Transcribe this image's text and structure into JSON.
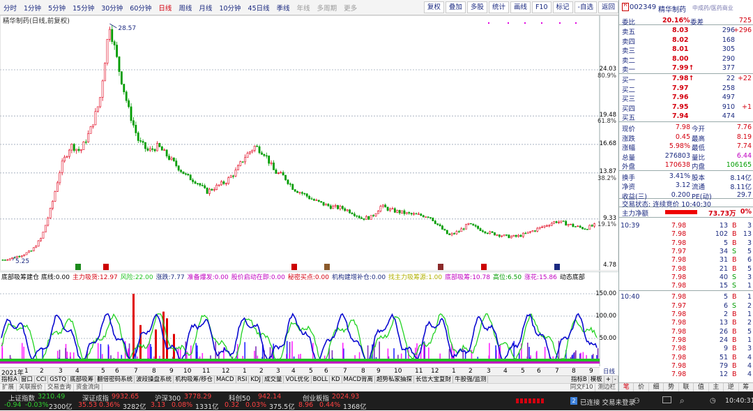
{
  "periods": [
    "分时",
    "1分钟",
    "5分钟",
    "15分钟",
    "30分钟",
    "60分钟",
    "日线",
    "周线",
    "月线",
    "10分钟",
    "45日线",
    "季线",
    "年线",
    "多周期",
    "更多"
  ],
  "active_period": "日线",
  "toolbar_buttons": [
    "复权",
    "叠加",
    "多股",
    "统计",
    "画线",
    "F10",
    "标记",
    "-自选",
    "返回"
  ],
  "chart_title": "精华制药(日线,前复权)",
  "price_axis": [
    "24.03",
    "19.48",
    "16.68",
    "13.87",
    "9.33",
    "4.78"
  ],
  "pct_axis": [
    "80.9%",
    "61.8%",
    "38.2%",
    "19.1%"
  ],
  "high_label": "28.57",
  "low_label": "5.25",
  "chart_data": {
    "type": "line",
    "title": "精华制药(日线,前复权)",
    "x": [
      "2021年",
      "1",
      "2",
      "3",
      "4",
      "5",
      "6",
      "7",
      "8",
      "9",
      "10",
      "11",
      "12",
      "1",
      "2",
      "3",
      "4",
      "5",
      "6",
      "7",
      "8",
      "9",
      "10",
      "11",
      "12",
      "1",
      "2",
      "3",
      "4",
      "5",
      "6",
      "7",
      "8",
      "9",
      "10",
      "11",
      "12"
    ],
    "ylim": [
      4.78,
      28.57
    ],
    "series": [
      {
        "values": [
          5.3,
          5.5,
          5.8,
          6.2,
          7.5,
          10.5,
          14.5,
          16.6,
          16.0,
          18.0,
          21.0,
          28.57,
          24.0,
          20.0,
          17.0,
          16.0,
          16.5,
          15.5,
          14.5,
          13.5,
          13.0,
          12.0,
          12.5,
          13.0,
          14.0,
          15.5,
          16.5,
          15.8,
          14.0,
          13.5,
          12.3,
          11.8,
          11.2,
          10.8,
          10.5,
          10.4,
          10.0,
          9.4,
          9.5,
          10.6,
          10.2,
          10.0,
          9.8,
          9.7,
          9.6,
          8.6,
          7.7,
          8.1,
          8.8,
          8.4,
          8.0,
          7.8,
          7.6,
          7.6,
          7.9,
          8.3,
          8.7,
          9.1,
          8.9,
          8.6,
          8.4,
          8.7
        ]
      }
    ]
  },
  "indicator_info": [
    {
      "label": "底部吸筹建仓 底线:",
      "value": "0.00",
      "color": "#000000"
    },
    {
      "label": "主力吸货:",
      "value": "12.97",
      "color": "#d4000f"
    },
    {
      "label": "风险:",
      "value": "22.00",
      "color": "#22c322"
    },
    {
      "label": "涨跌:",
      "value": "7.77",
      "color": "#1b2a80"
    },
    {
      "label": "准备爆发:",
      "value": "0.00",
      "color": "#c000c0"
    },
    {
      "label": "股价启动在即:",
      "value": "0.00",
      "color": "#c000c0"
    },
    {
      "label": "秘密买点:",
      "value": "0.00",
      "color": "#d4000f"
    },
    {
      "label": "机构建增补仓:",
      "value": "0.00",
      "color": "#1b2a80"
    },
    {
      "label": "找主力吸筹源:",
      "value": "1.00",
      "color": "#b0b000"
    },
    {
      "label": "底部吸筹:",
      "value": "10.78",
      "color": "#c000c0"
    },
    {
      "label": "高位:",
      "value": "6.50",
      "color": "#009c00"
    },
    {
      "label": "涨花:",
      "value": "15.86",
      "color": "#c000c0"
    },
    {
      "label": "动态底部",
      "value": "",
      "color": "#000000"
    }
  ],
  "indicator_axis": [
    "150.00",
    "100.00",
    "50.00"
  ],
  "x_axis_labels": [
    "2021年",
    "1",
    "2",
    "3",
    "4",
    "5",
    "6",
    "7",
    "8",
    "9",
    "10",
    "11",
    "12",
    "1",
    "2",
    "3",
    "4",
    "5",
    "6",
    "7",
    "8",
    "9",
    "10",
    "11",
    "12",
    "1",
    "2",
    "3",
    "4",
    "5",
    "6",
    "7",
    "8",
    "9",
    "10",
    "11",
    "12"
  ],
  "x_axis_unit": "日线",
  "indicator_tabs": [
    "指标A",
    "窗口",
    "CCI",
    "GSTQ",
    "底部吸筹",
    "翻倍密码系统",
    "波段操盘系统",
    "机构吸筹/移仓",
    "MACD",
    "RSI",
    "KDJ",
    "成交量",
    "VOL优化",
    "BOLL",
    "KD",
    "MACD背离",
    "超势私家抽探",
    "长信大宝复財",
    "牛股强/监测"
  ],
  "indicator_tabs_right": [
    "指标B",
    "模板",
    "+",
    "-"
  ],
  "bottom_tabs": [
    "扩展",
    "关联报价",
    "交易查询",
    "资金流向"
  ],
  "bottom_right_tabs": [
    "同文F10",
    "测边栏"
  ],
  "stock": {
    "code": "002349",
    "name": "精华制药",
    "subtitle": "中成药/医药商业",
    "weibi_label": "委比",
    "weibi": "20.16%",
    "weicha_label": "委差",
    "weicha": "725"
  },
  "asks": [
    {
      "label": "卖五",
      "price": "8.03",
      "vol": "296",
      "chg": "+296"
    },
    {
      "label": "卖四",
      "price": "8.02",
      "vol": "168",
      "chg": ""
    },
    {
      "label": "卖三",
      "price": "8.01",
      "vol": "305",
      "chg": ""
    },
    {
      "label": "卖二",
      "price": "8.00",
      "vol": "290",
      "chg": ""
    },
    {
      "label": "卖一",
      "price": "7.99↑",
      "vol": "377",
      "chg": ""
    }
  ],
  "bids": [
    {
      "label": "买一",
      "price": "7.98↑",
      "vol": "22",
      "chg": "+22"
    },
    {
      "label": "买二",
      "price": "7.97",
      "vol": "258",
      "chg": ""
    },
    {
      "label": "买三",
      "price": "7.96",
      "vol": "497",
      "chg": ""
    },
    {
      "label": "买四",
      "price": "7.95",
      "vol": "910",
      "chg": "+1"
    },
    {
      "label": "买五",
      "price": "7.94",
      "vol": "474",
      "chg": ""
    }
  ],
  "quote": [
    {
      "l1": "现价",
      "v1": "7.98",
      "l2": "今开",
      "v2": "7.76"
    },
    {
      "l1": "涨跌",
      "v1": "0.45",
      "l2": "最高",
      "v2": "8.19"
    },
    {
      "l1": "涨幅",
      "v1": "5.98%",
      "l2": "最低",
      "v2": "7.74"
    },
    {
      "l1": "总量",
      "v1": "276803",
      "l2": "量比",
      "v2": "6.44"
    },
    {
      "l1": "外盘",
      "v1": "170638",
      "l2": "内盘",
      "v2": "106165"
    },
    {
      "l1": "换手",
      "v1": "3.41%",
      "l2": "股本",
      "v2": "8.14亿"
    },
    {
      "l1": "净资",
      "v1": "3.12",
      "l2": "流通",
      "v2": "8.11亿"
    },
    {
      "l1": "收益(三)",
      "v1": "0.200",
      "l2": "PE(动)",
      "v2": "29.7"
    }
  ],
  "trade_status": "交易状态: 连续竞价 10:40:30",
  "main_net_label": "主力净额",
  "main_net_value": "73.73万",
  "main_net_pct": "0%",
  "ticks": [
    {
      "time": "10:39",
      "price": "7.98",
      "vol": "13",
      "side": "B",
      "n": "3"
    },
    {
      "time": "",
      "price": "7.98",
      "vol": "102",
      "side": "B",
      "n": "13"
    },
    {
      "time": "",
      "price": "7.98",
      "vol": "5",
      "side": "B",
      "n": "3"
    },
    {
      "time": "",
      "price": "7.97",
      "vol": "34",
      "side": "S",
      "n": "5"
    },
    {
      "time": "",
      "price": "7.98",
      "vol": "31",
      "side": "B",
      "n": "6"
    },
    {
      "time": "",
      "price": "7.98",
      "vol": "21",
      "side": "B",
      "n": "5"
    },
    {
      "time": "",
      "price": "7.98",
      "vol": "40",
      "side": "S",
      "n": "3"
    },
    {
      "time": "",
      "price": "7.98",
      "vol": "15",
      "side": "S",
      "n": "1"
    },
    {
      "time": "10:40",
      "price": "7.98",
      "vol": "5",
      "side": "B",
      "n": "1"
    },
    {
      "time": "",
      "price": "7.97",
      "vol": "6",
      "side": "S",
      "n": "2"
    },
    {
      "time": "",
      "price": "7.98",
      "vol": "2",
      "side": "B",
      "n": "1"
    },
    {
      "time": "",
      "price": "7.98",
      "vol": "13",
      "side": "B",
      "n": "2"
    },
    {
      "time": "",
      "price": "7.98",
      "vol": "26",
      "side": "B",
      "n": "5"
    },
    {
      "time": "",
      "price": "7.98",
      "vol": "24",
      "side": "B",
      "n": "1"
    },
    {
      "time": "",
      "price": "7.98",
      "vol": "9",
      "side": "B",
      "n": "3"
    },
    {
      "time": "",
      "price": "7.98",
      "vol": "51",
      "side": "B",
      "n": "4"
    },
    {
      "time": "",
      "price": "7.98",
      "vol": "79",
      "side": "B",
      "n": "4"
    },
    {
      "time": "",
      "price": "7.98",
      "vol": "12",
      "side": "B",
      "n": "4"
    }
  ],
  "right_tabs": [
    "笔",
    "价",
    "细",
    "势",
    "联",
    "值",
    "主",
    "逆",
    "筹"
  ],
  "status_bar": {
    "indices": [
      {
        "name": "上证指数",
        "value": "3210.49",
        "chg": "-0.94",
        "pct": "-0.03%",
        "amt": "2300亿"
      },
      {
        "name": "深证成指",
        "value": "9932.65",
        "chg": "35.53",
        "pct": "0.36%",
        "amt": "3282亿"
      },
      {
        "name": "沪深300",
        "value": "3778.29",
        "chg": "3.13",
        "pct": "0.08%",
        "amt": "1331亿"
      },
      {
        "name": "科创50",
        "value": "942.14",
        "chg": "0.32",
        "pct": "0.03%",
        "amt": "375.5亿"
      },
      {
        "name": "创业板指",
        "value": "2024.93",
        "chg": "8.96",
        "pct": "0.44%",
        "amt": "1368亿"
      }
    ],
    "connection": "已连接 交易未登录",
    "connection_num": "2",
    "time": "10:40:31"
  }
}
